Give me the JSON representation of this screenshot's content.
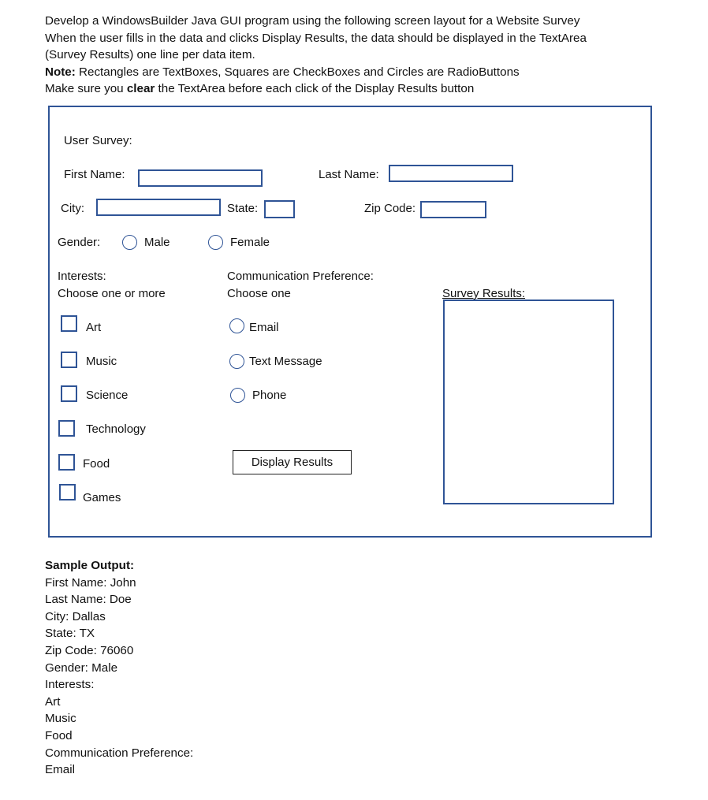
{
  "instructions": {
    "line1": "Develop a WindowsBuilder Java GUI program using the following screen layout for a Website Survey",
    "line2": "When the user fills in the data and clicks Display Results, the data should be displayed in the TextArea",
    "line3": "(Survey Results) one line per data item.",
    "note_label": "Note:",
    "note_text": " Rectangles are TextBoxes, Squares are CheckBoxes and Circles are RadioButtons",
    "clear_pre": "Make sure you ",
    "clear_bold": "clear",
    "clear_post": " the TextArea before each click of the Display Results button"
  },
  "form": {
    "title": "User Survey:",
    "first_name_label": "First Name:",
    "first_name_value": "",
    "last_name_label": "Last Name:",
    "last_name_value": "",
    "city_label": "City:",
    "city_value": "",
    "state_label": "State:",
    "state_value": "",
    "zip_label": "Zip  Code:",
    "zip_value": "",
    "gender_label": "Gender:",
    "gender_options": [
      "Male",
      "Female"
    ],
    "interests_label": "Interests:",
    "interests_hint": "Choose one or more",
    "interests": [
      "Art",
      "Music",
      "Science",
      "Technology",
      "Food",
      "Games"
    ],
    "comm_label": "Communication Preference:",
    "comm_hint": "Choose one",
    "comm_options": [
      "Email",
      "Text Message",
      "Phone"
    ],
    "display_button": "Display Results",
    "results_label": "Survey Results:",
    "results_value": ""
  },
  "sample_output": {
    "heading": "Sample Output:",
    "lines": [
      "First Name: John",
      "Last Name: Doe",
      "City: Dallas",
      "State: TX",
      "Zip Code: 76060",
      "Gender: Male",
      "Interests:",
      "Art",
      "Music",
      "Food",
      "Communication Preference:",
      "Email"
    ]
  },
  "colors": {
    "control_border": "#2f5496",
    "text": "#111111"
  }
}
